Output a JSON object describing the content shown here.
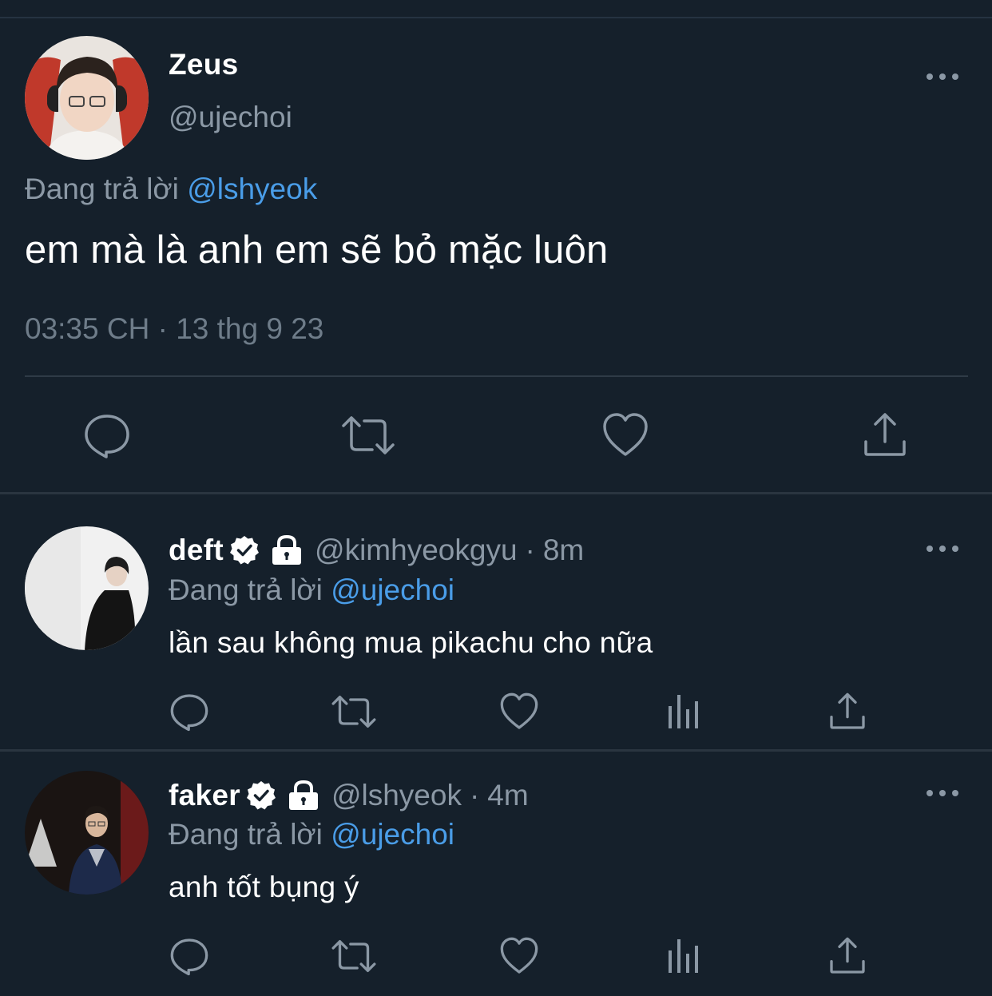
{
  "main_tweet": {
    "name": "Zeus",
    "handle": "@ujechoi",
    "reply_prefix": "Đang trả lời",
    "reply_to": "@lshyeok",
    "text": "em mà là anh em sẽ bỏ mặc luôn",
    "timestamp": "03:35 CH · 13 thg 9 23",
    "actions": [
      "reply-icon",
      "retweet-icon",
      "like-icon",
      "share-icon"
    ]
  },
  "replies": [
    {
      "name": "deft",
      "verified": true,
      "protected": true,
      "handle": "@kimhyeokgyu",
      "separator": "·",
      "time": "8m",
      "reply_prefix": "Đang trả lời",
      "reply_to": "@ujechoi",
      "text": "lần sau không mua pikachu cho nữa",
      "actions": [
        "reply-icon",
        "retweet-icon",
        "like-icon",
        "analytics-icon",
        "share-icon"
      ]
    },
    {
      "name": "faker",
      "verified": true,
      "protected": true,
      "handle": "@lshyeok",
      "separator": "·",
      "time": "4m",
      "reply_prefix": "Đang trả lời",
      "reply_to": "@ujechoi",
      "text": "anh tốt bụng ý",
      "actions": [
        "reply-icon",
        "retweet-icon",
        "like-icon",
        "analytics-icon",
        "share-icon"
      ]
    }
  ],
  "colors": {
    "background": "#15202b",
    "secondary_text": "#8b98a5",
    "link": "#4a9de8",
    "icon": "#8b98a5"
  }
}
